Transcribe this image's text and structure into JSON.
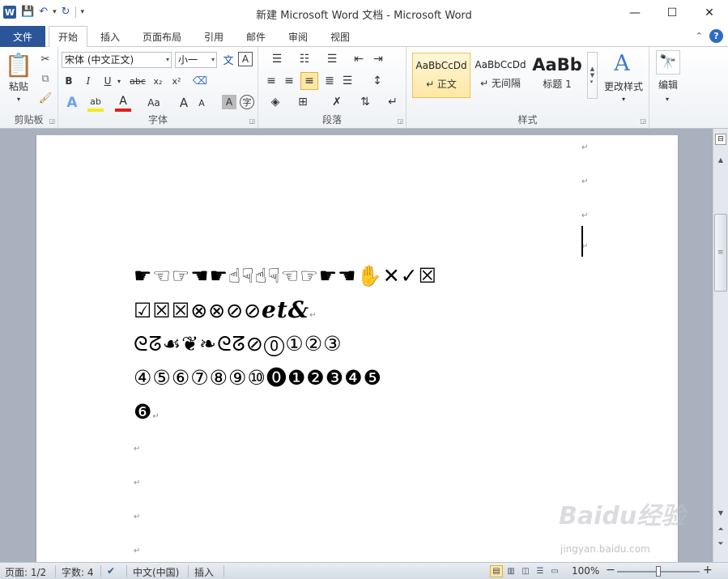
{
  "window": {
    "title": "新建 Microsoft Word 文档  -  Microsoft Word",
    "app_letter": "W",
    "minimize": "—",
    "maximize": "☐",
    "close": "✕"
  },
  "tabs": {
    "file": "文件",
    "items": [
      "开始",
      "插入",
      "页面布局",
      "引用",
      "邮件",
      "审阅",
      "视图"
    ],
    "active": "开始"
  },
  "ribbon": {
    "clipboard": {
      "label": "剪贴板",
      "paste": "粘贴"
    },
    "font": {
      "label": "字体",
      "font_name": "宋体 (中文正文)",
      "font_size": "小一",
      "bold": "B",
      "italic": "I",
      "underline": "U",
      "strike": "abc",
      "subscript": "x₂",
      "superscript": "x²",
      "change_case": "Aa",
      "grow": "A",
      "shrink": "A",
      "char_border": "A",
      "wen": "文",
      "zi": "字"
    },
    "paragraph": {
      "label": "段落"
    },
    "styles": {
      "label": "样式",
      "items": [
        {
          "preview": "AaBbCcDd",
          "name": "↵ 正文"
        },
        {
          "preview": "AaBbCcDd",
          "name": "↵ 无间隔"
        },
        {
          "preview": "AaBb",
          "name": "标题 1"
        }
      ],
      "change_styles": "更改样式"
    },
    "editing": {
      "label": "编辑"
    }
  },
  "document": {
    "lines": [
      "☛☜☞☚☛☝☟☝☟☜☞☛☚✋✕✓☒",
      "☑☒☒⊗⊗⊘⊘",
      "ᘓᘔ☙❦❧ᘓᘔ⊘⓪①②③",
      "④⑤⑥⑦⑧⑨⑩⓿❶❷❸❹❺",
      "❻"
    ],
    "ampersand": "et&",
    "para_mark": "↵"
  },
  "statusbar": {
    "page": "页面: 1/2",
    "words": "字数: 4",
    "language": "中文(中国)",
    "mode": "插入",
    "zoom": "100%",
    "zoom_minus": "−",
    "zoom_plus": "+"
  },
  "watermark": {
    "text": "Baidu经验",
    "sub": "jingyan.baidu.com"
  }
}
